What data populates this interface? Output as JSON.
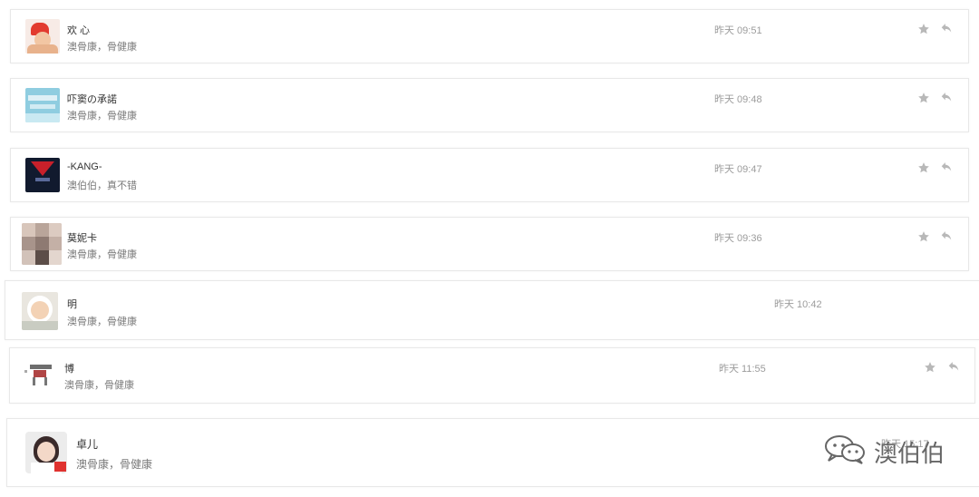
{
  "messages": [
    {
      "name": "欢 心",
      "text": "澳骨康，骨健康",
      "time": "昨天 09:51"
    },
    {
      "name": "吓窦の承諾",
      "text": "澳骨康，骨健康",
      "time": "昨天 09:48"
    },
    {
      "name": "-KANG-",
      "text": "澳伯伯，真不错",
      "time": "昨天 09:47"
    },
    {
      "name": "莫妮卡",
      "text": "澳骨康，骨健康",
      "time": "昨天 09:36"
    },
    {
      "name": "明",
      "text": "澳骨康，骨健康",
      "time": "昨天 10:42"
    },
    {
      "name": "博",
      "text": "澳骨康，骨健康",
      "time": "昨天 11:55"
    },
    {
      "name": "卓儿",
      "text": "澳骨康，骨健康",
      "time": "昨天 15:17"
    }
  ],
  "icons": {
    "star": "star-icon",
    "reply": "reply-icon"
  },
  "watermark": {
    "text": "澳伯伯"
  },
  "colors": {
    "border": "#e8e8e8",
    "name": "#333333",
    "text": "#7a7a7a",
    "time": "#9c9c9c",
    "icon": "#b8b8b8"
  }
}
